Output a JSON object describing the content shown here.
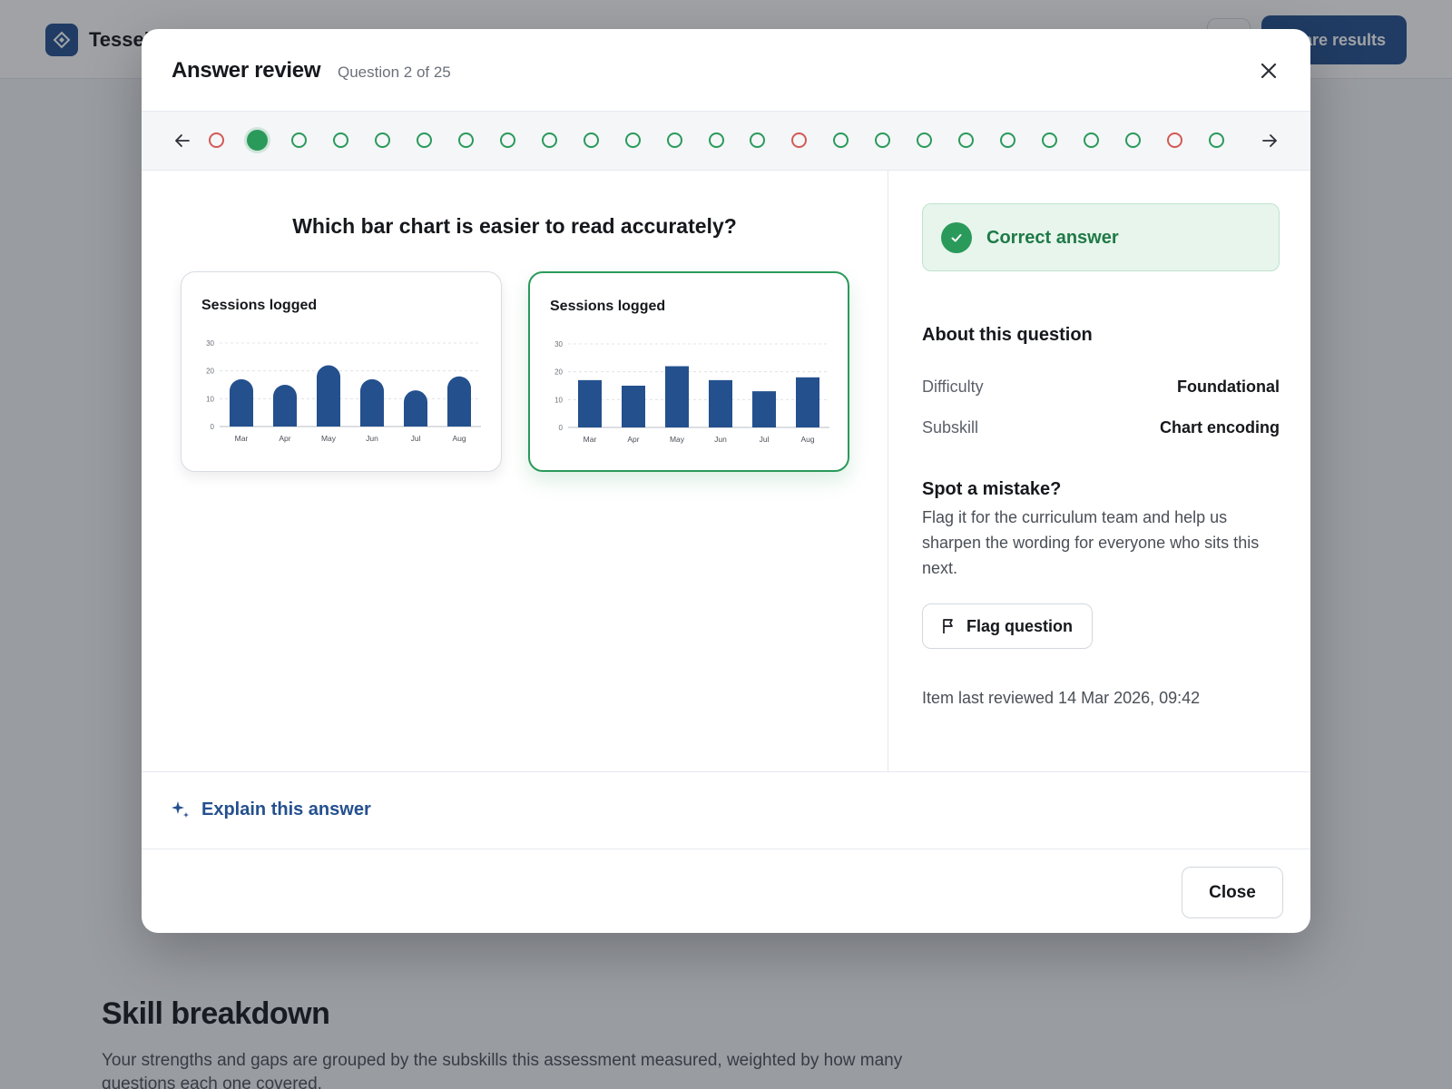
{
  "app": {
    "brand": "Tessel",
    "primary_action": "Share results"
  },
  "page": {
    "section_title": "Skill breakdown",
    "section_text": "Your strengths and gaps are grouped by the subskills this assessment measured, weighted by how many questions each one covered."
  },
  "modal": {
    "title": "Answer review",
    "subtitle": "Question 2 of 25",
    "question_statuses": [
      "wrong",
      "correct",
      "correct",
      "correct",
      "correct",
      "correct",
      "correct",
      "correct",
      "correct",
      "correct",
      "correct",
      "correct",
      "correct",
      "correct",
      "wrong",
      "correct",
      "correct",
      "correct",
      "correct",
      "correct",
      "correct",
      "correct",
      "correct",
      "wrong",
      "correct"
    ],
    "current_index": 1,
    "question": "Which bar chart is easier to read accurately?",
    "options": [
      {
        "title": "Sessions logged",
        "bar_style": "rounded",
        "selected": false
      },
      {
        "title": "Sessions logged",
        "bar_style": "square",
        "selected": true
      }
    ],
    "status": {
      "label": "Correct answer",
      "color": "#2a9a5a"
    },
    "about": {
      "heading": "About this question",
      "rows": [
        {
          "label": "Difficulty",
          "value": "Foundational"
        },
        {
          "label": "Subskill",
          "value": "Chart encoding"
        }
      ]
    },
    "mistake": {
      "heading": "Spot a mistake?",
      "text": "Flag it for the curriculum team and help us sharpen the wording for everyone who sits this next.",
      "button": "Flag question"
    },
    "reviewed": "Item last reviewed 14 Mar 2026, 09:42",
    "explain_label": "Explain this answer",
    "close_label": "Close"
  },
  "chart_data": [
    {
      "type": "bar",
      "title": "Sessions logged",
      "categories": [
        "Mar",
        "Apr",
        "May",
        "Jun",
        "Jul",
        "Aug"
      ],
      "values": [
        17,
        15,
        22,
        17,
        13,
        18
      ],
      "yticks": [
        0,
        10,
        20,
        30
      ],
      "ylim": [
        0,
        30
      ],
      "grid": true,
      "bar_color": "#24508e"
    },
    {
      "type": "bar",
      "title": "Sessions logged",
      "categories": [
        "Mar",
        "Apr",
        "May",
        "Jun",
        "Jul",
        "Aug"
      ],
      "values": [
        17,
        15,
        22,
        17,
        13,
        18
      ],
      "yticks": [
        0,
        10,
        20,
        30
      ],
      "ylim": [
        0,
        30
      ],
      "grid": true,
      "bar_color": "#24508e"
    }
  ]
}
